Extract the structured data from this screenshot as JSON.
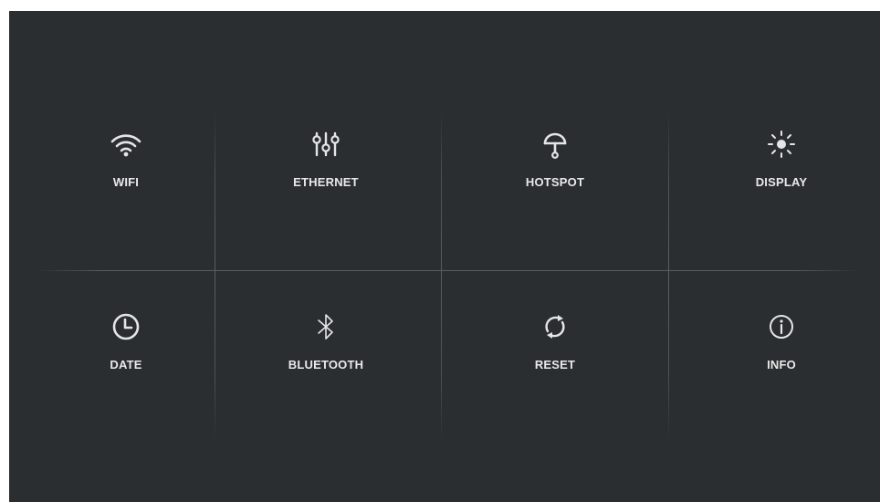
{
  "colors": {
    "background": "#2b2e30",
    "text": "#e8e9ea",
    "icon": "#e4e5e6",
    "divider": "#5a5e61"
  },
  "tiles": [
    {
      "label": "WIFI",
      "icon": "wifi-icon"
    },
    {
      "label": "ETHERNET",
      "icon": "sliders-icon"
    },
    {
      "label": "HOTSPOT",
      "icon": "hotspot-icon"
    },
    {
      "label": "DISPLAY",
      "icon": "brightness-icon"
    },
    {
      "label": "DATE",
      "icon": "clock-icon"
    },
    {
      "label": "BLUETOOTH",
      "icon": "bluetooth-icon"
    },
    {
      "label": "RESET",
      "icon": "refresh-icon"
    },
    {
      "label": "INFO",
      "icon": "info-icon"
    }
  ]
}
